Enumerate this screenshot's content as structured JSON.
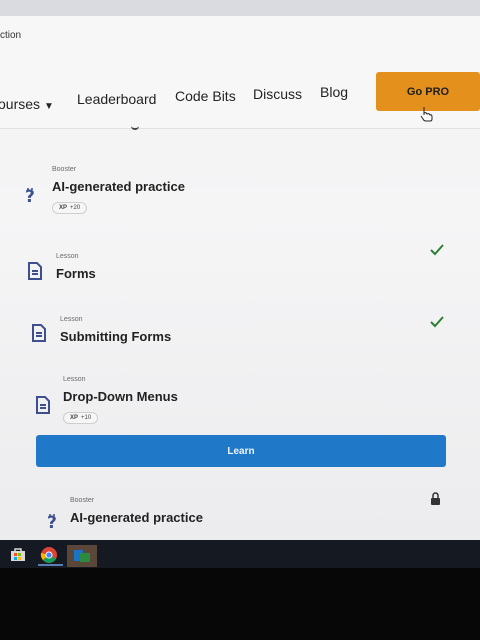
{
  "browser": {
    "address_fragment": "ction"
  },
  "nav": {
    "courses": "ourses",
    "leaderboard": "Leaderboard",
    "code_bits": "Code Bits",
    "discuss": "Discuss",
    "blog": "Blog",
    "go_pro": "Go PRO"
  },
  "items": [
    {
      "type": "Booster",
      "title": "AI-generated practice",
      "xp_label": "XP",
      "xp_value": "+20",
      "icon": "question-mark-icon",
      "completed": false
    },
    {
      "type": "Lesson",
      "title": "Forms",
      "icon": "lesson-doc-icon",
      "completed": true
    },
    {
      "type": "Lesson",
      "title": "Submitting Forms",
      "icon": "lesson-doc-icon",
      "completed": true
    },
    {
      "type": "Lesson",
      "title": "Drop-Down Menus",
      "xp_label": "XP",
      "xp_value": "+10",
      "icon": "lesson-doc-icon",
      "completed": false
    },
    {
      "type": "Booster",
      "title": "AI-generated practice",
      "icon": "question-mark-icon",
      "locked": true
    }
  ],
  "learn_button": "Learn",
  "colors": {
    "go_pro": "#e4901d",
    "learn": "#1f78c8",
    "check": "#2e7d32",
    "icon": "#3d4f8f"
  },
  "taskbar": {
    "icons": [
      "store-icon",
      "chrome-icon",
      "app-icon"
    ]
  }
}
